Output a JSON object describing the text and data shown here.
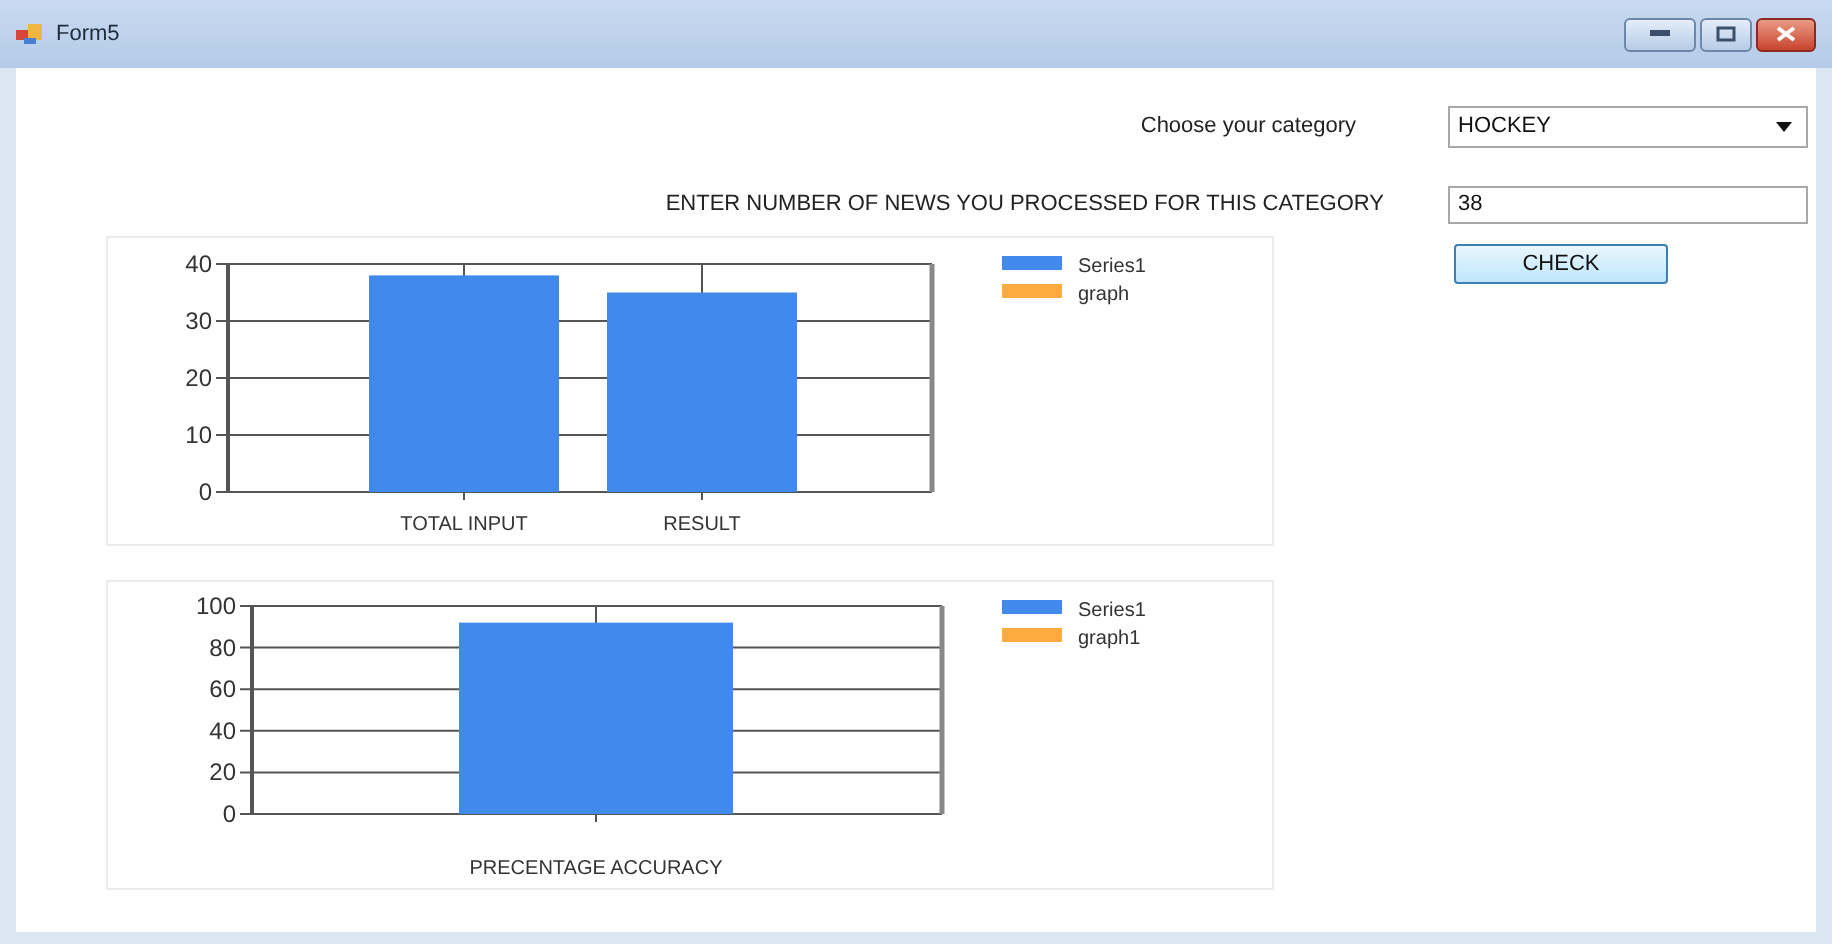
{
  "window": {
    "title": "Form5"
  },
  "category": {
    "label": "Choose your category",
    "value": "HOCKEY"
  },
  "news_count": {
    "label": "ENTER NUMBER OF NEWS YOU PROCESSED FOR THIS CATEGORY",
    "value": "38"
  },
  "check_button": {
    "label": "CHECK"
  },
  "charts": [
    {
      "chart_data": {
        "type": "bar",
        "categories": [
          "TOTAL INPUT",
          "RESULT"
        ],
        "series": [
          {
            "name": "Series1",
            "color": "#4189eb",
            "values": [
              38,
              35
            ]
          },
          {
            "name": "graph",
            "color": "#ffab40",
            "values": [
              null,
              null
            ]
          }
        ],
        "ylim": [
          0,
          40
        ],
        "yticks": [
          0,
          10,
          20,
          30,
          40
        ],
        "grid": true
      }
    },
    {
      "chart_data": {
        "type": "bar",
        "categories": [
          "PRECENTAGE ACCURACY"
        ],
        "series": [
          {
            "name": "Series1",
            "color": "#4189eb",
            "values": [
              92
            ]
          },
          {
            "name": "graph1",
            "color": "#ffab40",
            "values": [
              null
            ]
          }
        ],
        "ylim": [
          0,
          100
        ],
        "yticks": [
          0,
          20,
          40,
          60,
          80,
          100
        ],
        "grid": true
      }
    }
  ]
}
